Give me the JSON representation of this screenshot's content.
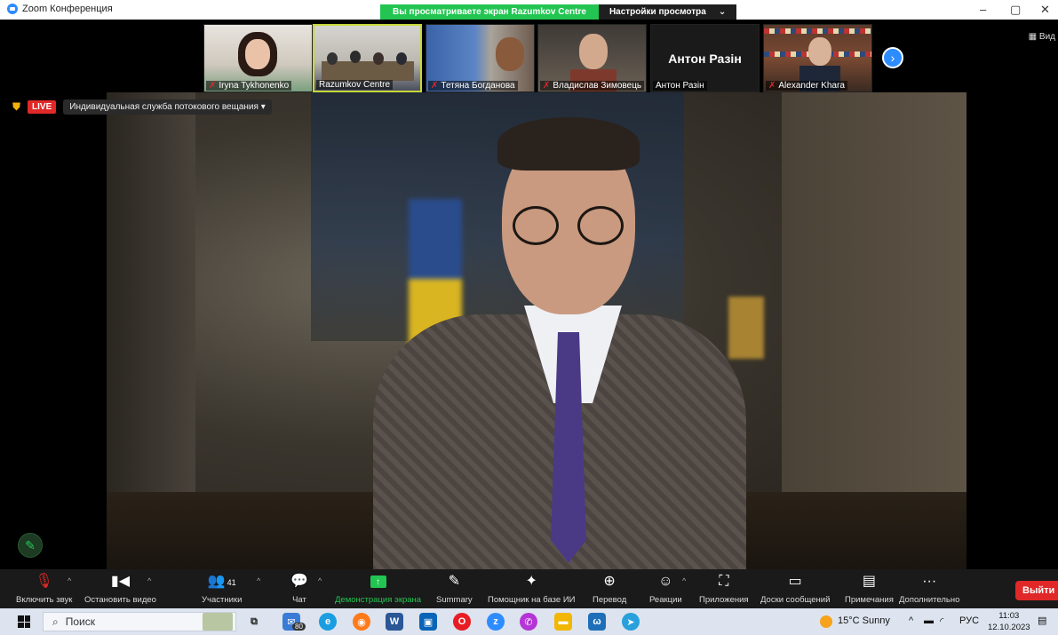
{
  "window": {
    "app_title": "Zoom Конференция",
    "share_notice": "Вы просматриваете экран Razumkov Centre",
    "view_settings": "Настройки просмотра",
    "view_settings_chevron": "⌄",
    "minimize": "–",
    "maximize": "▢",
    "close": "✕"
  },
  "participants": [
    {
      "name": "Iryna Tykhonenko",
      "muted": true
    },
    {
      "name": "Razumkov Centre",
      "muted": false,
      "active": true
    },
    {
      "name": "Тетяна Богданова",
      "muted": true
    },
    {
      "name": "Владислав Зимовець",
      "muted": true
    },
    {
      "name": "Антон Разін",
      "muted": false,
      "video_off": true
    },
    {
      "name": "Alexander Khara",
      "muted": true
    }
  ],
  "strip": {
    "next_icon": "›",
    "view_label": "Вид"
  },
  "stream": {
    "live_label": "LIVE",
    "service": "Индивидуальная служба потокового вещания",
    "service_caret": "▾"
  },
  "toolbar": {
    "items": [
      {
        "icon": "🎤",
        "label": "Включить звук"
      },
      {
        "icon": "▮◀",
        "label": "Остановить видео"
      },
      {
        "icon": "👥",
        "count": "41",
        "label": "Участники"
      },
      {
        "icon": "💬",
        "label": "Чат"
      },
      {
        "icon": "↑",
        "label": "Демонстрация экрана"
      },
      {
        "icon": "✎",
        "label": "Summary"
      },
      {
        "icon": "✦",
        "label": "Помощник на базе ИИ"
      },
      {
        "icon": "⊕",
        "label": "Перевод"
      },
      {
        "icon": "☺",
        "label": "Реакции"
      },
      {
        "icon": "⛶",
        "label": "Приложения"
      },
      {
        "icon": "▭",
        "label": "Доски сообщений"
      },
      {
        "icon": "▤",
        "label": "Примечания"
      },
      {
        "icon": "···",
        "label": "Дополнительно"
      }
    ],
    "caret": "^",
    "exit_label": "Выйти"
  },
  "taskbar": {
    "search_placeholder": "Поиск",
    "mail_badge": "80",
    "weather": "15°C  Sunny",
    "language": "РУС",
    "time": "11:03",
    "date": "12.10.2023"
  },
  "colors": {
    "zoom_blue": "#2d8cff",
    "share_green": "#23c552",
    "live_red": "#e02828",
    "exit_red": "#e02828"
  }
}
